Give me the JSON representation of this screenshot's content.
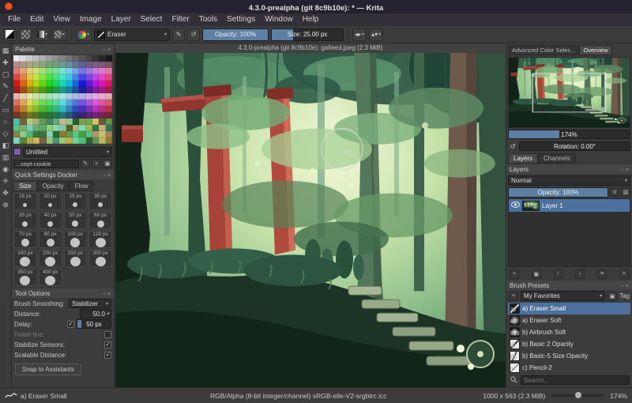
{
  "window": {
    "title": "4.3.0-prealpha (git 8c9b10e): * — Krita"
  },
  "menubar": {
    "items": [
      "File",
      "Edit",
      "View",
      "Image",
      "Layer",
      "Select",
      "Filter",
      "Tools",
      "Settings",
      "Window",
      "Help"
    ]
  },
  "glyphs": {
    "dropdown": "▾",
    "spin": "▴▾",
    "float": "▫",
    "close": "×",
    "edit": "✎",
    "reload": "↺",
    "mirror": "◂▸",
    "wrap": "▴▾",
    "alpha": "α",
    "alpha_lock": "▨",
    "rotate": "↺",
    "plus": "+",
    "tag": "▣",
    "check": "✓"
  },
  "toolbar": {
    "brush_preset": "Eraser",
    "opacity": "Opacity: 100%",
    "size": "Size: 25.00 px"
  },
  "toolbox": {
    "tools": [
      {
        "name": "transform-tool",
        "glyph": "▦"
      },
      {
        "name": "move-tool",
        "glyph": "✚"
      },
      {
        "name": "crop-tool",
        "glyph": "▢"
      },
      {
        "name": "freehand-brush-tool",
        "glyph": "✎"
      },
      {
        "name": "line-tool",
        "glyph": "╱"
      },
      {
        "name": "rectangle-tool",
        "glyph": "▭"
      },
      {
        "name": "ellipse-tool",
        "glyph": "○"
      },
      {
        "name": "polygon-tool",
        "glyph": "◇"
      },
      {
        "name": "fill-tool",
        "glyph": "◧"
      },
      {
        "name": "gradient-tool",
        "glyph": "▥"
      },
      {
        "name": "color-sampler-tool",
        "glyph": "◉"
      },
      {
        "name": "assistants-tool",
        "glyph": "✛"
      },
      {
        "name": "pan-tool",
        "glyph": "✥"
      },
      {
        "name": "zoom-tool",
        "glyph": "⊕"
      }
    ]
  },
  "palette": {
    "title": "Palette",
    "name": "Untitled",
    "file": "...cept-cookie",
    "rows": 14,
    "cols": 15
  },
  "quick_settings": {
    "title": "Quick Settings Docker",
    "tabs": [
      "Size",
      "Opacity",
      "Flow"
    ],
    "active_tab": "Size",
    "sizes": [
      "16 px",
      "20 px",
      "25 px",
      "30 px",
      "35 px",
      "40 px",
      "50 px",
      "60 px",
      "70 px",
      "80 px",
      "100 px",
      "120 px",
      "160 px",
      "200 px",
      "250 px",
      "300 px",
      "350 px",
      "400 px"
    ]
  },
  "tool_options": {
    "title": "Tool Options",
    "brush_smoothing_label": "Brush Smoothing:",
    "brush_smoothing_value": "Stabilizer",
    "distance_label": "Distance:",
    "distance_value": "50.0",
    "delay_label": "Delay:",
    "delay_value": "50 px",
    "finish_line_label": "Finish line:",
    "stabilize_sensors_label": "Stabilize Sensors:",
    "scalable_distance_label": "Scalable Distance:",
    "snap_label": "Snap to Assistants"
  },
  "canvas": {
    "doc_title": "4.3.0-prealpha (git 8c9b10e): galteed.jpeg (2.3 MiB)"
  },
  "overview": {
    "tabs": [
      "Advanced Color Selec...",
      "Overview"
    ],
    "active_tab": "Overview",
    "zoom": "174%",
    "rotation": "Rotation: 0.00°"
  },
  "layers": {
    "tabs": [
      "Layers",
      "Channels"
    ],
    "active_tab": "Layers",
    "title": "Layers",
    "blend_mode": "Normal",
    "opacity": "Opacity: 100%",
    "items": [
      {
        "name": "Layer 1"
      }
    ],
    "buttons": [
      {
        "name": "add-layer-button",
        "glyph": "+"
      },
      {
        "name": "duplicate-layer-button",
        "glyph": "▣"
      },
      {
        "name": "move-layer-up-button",
        "glyph": "↑"
      },
      {
        "name": "move-layer-down-button",
        "glyph": "↓"
      },
      {
        "name": "layer-properties-button",
        "glyph": "≡"
      },
      {
        "name": "delete-layer-button",
        "glyph": "×"
      }
    ]
  },
  "brush_presets": {
    "title": "Brush Presets",
    "tag_filter": "My Favorites",
    "tag_label": "Tag",
    "search_placeholder": "Search...",
    "items": [
      {
        "badge": "25",
        "name": "a) Eraser Small",
        "thumb": "dark-line"
      },
      {
        "badge": "60",
        "name": "a) Eraser Soft",
        "thumb": "dark-soft"
      },
      {
        "badge": "5.72",
        "name": "b) Airbrush Soft",
        "thumb": "dark-blob"
      },
      {
        "badge": "40",
        "name": "b) Basic 2 Opacity",
        "thumb": "light-line"
      },
      {
        "badge": "40",
        "name": "b) Basic-5 Size Opacity",
        "thumb": "light-taper"
      },
      {
        "badge": "1",
        "name": "c) Pencil-2",
        "thumb": "light-thin"
      }
    ]
  },
  "statusbar": {
    "brush": "a) Eraser Small",
    "profile": "RGB/Alpha (8-bit integer/channel)  sRGB-elle-V2-srgbtrc.icc",
    "dimensions": "1000 x 563 (2.3 MiB)",
    "zoom": "174%"
  },
  "colors": {
    "selection": "#4d719e",
    "slider_fill": "#5c7fa3",
    "titlebar": "#262130",
    "close_button": "#e95420"
  }
}
